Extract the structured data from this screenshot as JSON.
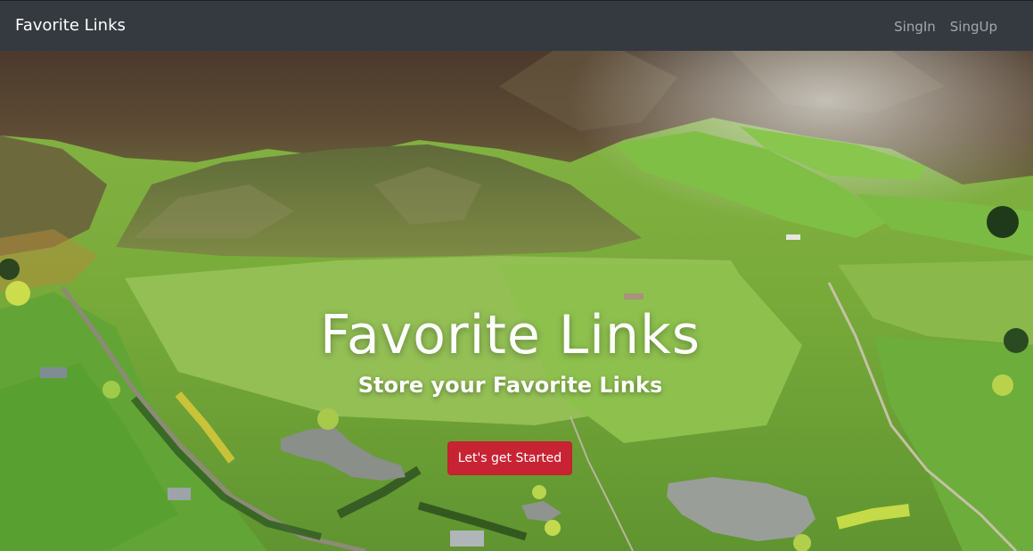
{
  "navbar": {
    "brand": "Favorite Links",
    "links": [
      {
        "label": "SingIn"
      },
      {
        "label": "SingUp"
      }
    ]
  },
  "hero": {
    "title": "Favorite Links",
    "subtitle": "Store your Favorite Links",
    "cta_label": "Let's get Started",
    "background": "aerial-valley-landscape-image"
  },
  "colors": {
    "navbar_bg": "#343a40",
    "cta_bg": "#c82333",
    "text_light": "#ffffff",
    "nav_link": "#9a9da0"
  }
}
